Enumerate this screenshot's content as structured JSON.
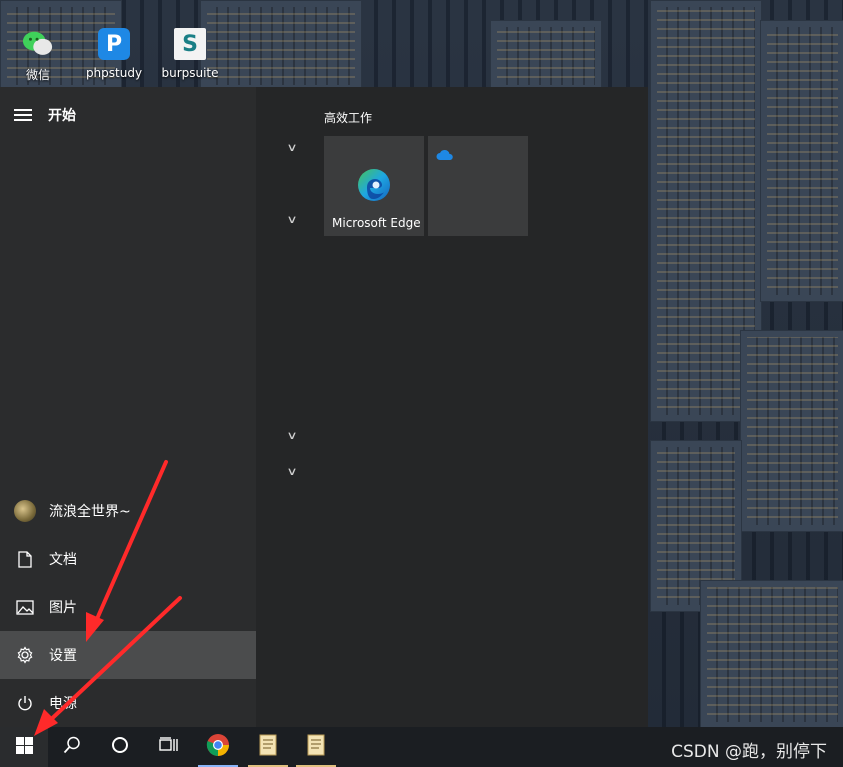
{
  "desktop": {
    "icons": [
      {
        "label": "微信",
        "icon": "wechat-icon"
      },
      {
        "label": "phpstudy",
        "icon": "phpstudy-icon",
        "glyph": "P"
      },
      {
        "label": "burpsuite",
        "icon": "burpsuite-icon",
        "glyph": "S"
      }
    ]
  },
  "start_menu": {
    "header_label": "开始",
    "nav": {
      "user": "流浪全世界~",
      "documents": "文档",
      "pictures": "图片",
      "settings": "设置",
      "power": "电源"
    },
    "group_title": "高效工作",
    "tiles": {
      "edge_label": "Microsoft Edge"
    }
  },
  "taskbar": {
    "watermark": "CSDN @跑，别停下"
  },
  "colors": {
    "annotation_arrow": "#ff2a2a",
    "edge_blue": "#1e88e5",
    "edge_green": "#46c35a"
  }
}
